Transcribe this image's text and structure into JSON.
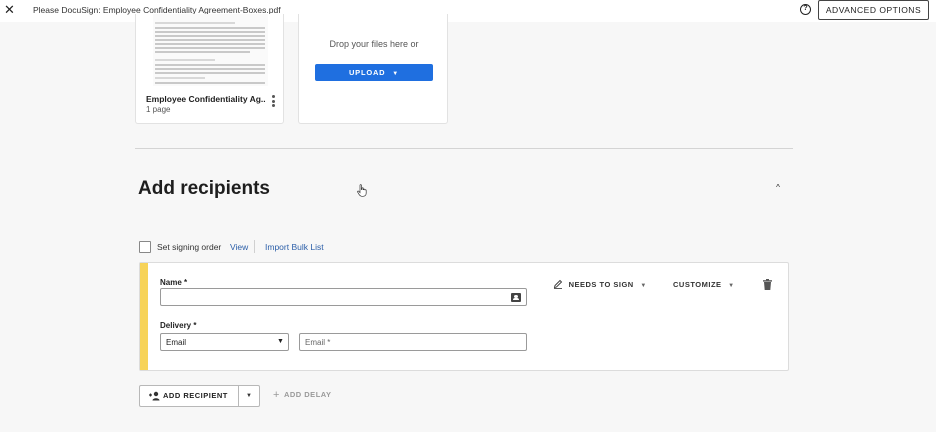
{
  "header": {
    "title": "Please DocuSign: Employee Confidentiality Agreement-Boxes.pdf",
    "close_icon": "close-icon",
    "help_icon": "help-circle-icon",
    "help_glyph": "?",
    "advanced_options_label": "ADVANCED OPTIONS"
  },
  "documents": [
    {
      "name": "Employee Confidentiality Ag...",
      "pages": "1 page",
      "menu_icon": "kebab-menu-icon"
    }
  ],
  "upload": {
    "drop_text": "Drop your files here or",
    "button_label": "UPLOAD",
    "button_caret": "▼"
  },
  "recipients_section": {
    "title": "Add recipients",
    "collapse_glyph": "^",
    "signing_order_label": "Set signing order",
    "view_link": "View",
    "import_link": "Import Bulk List"
  },
  "recipient": {
    "accent_color": "#f7d358",
    "name_label": "Name *",
    "name_value": "",
    "delivery_label": "Delivery *",
    "delivery_value": "Email",
    "delivery_caret": "▼",
    "email_placeholder": "Email *",
    "email_value": "",
    "role_label": "NEEDS TO SIGN",
    "role_caret": "▼",
    "customize_label": "CUSTOMIZE",
    "customize_caret": "▼"
  },
  "actions": {
    "add_recipient_label": "ADD RECIPIENT",
    "add_recipient_caret": "▼",
    "add_delay_label": "ADD DELAY",
    "add_delay_plus": "+"
  },
  "colors": {
    "primary": "#1f6fe0",
    "link": "#2b5ea8",
    "background": "#f7f7f7"
  }
}
